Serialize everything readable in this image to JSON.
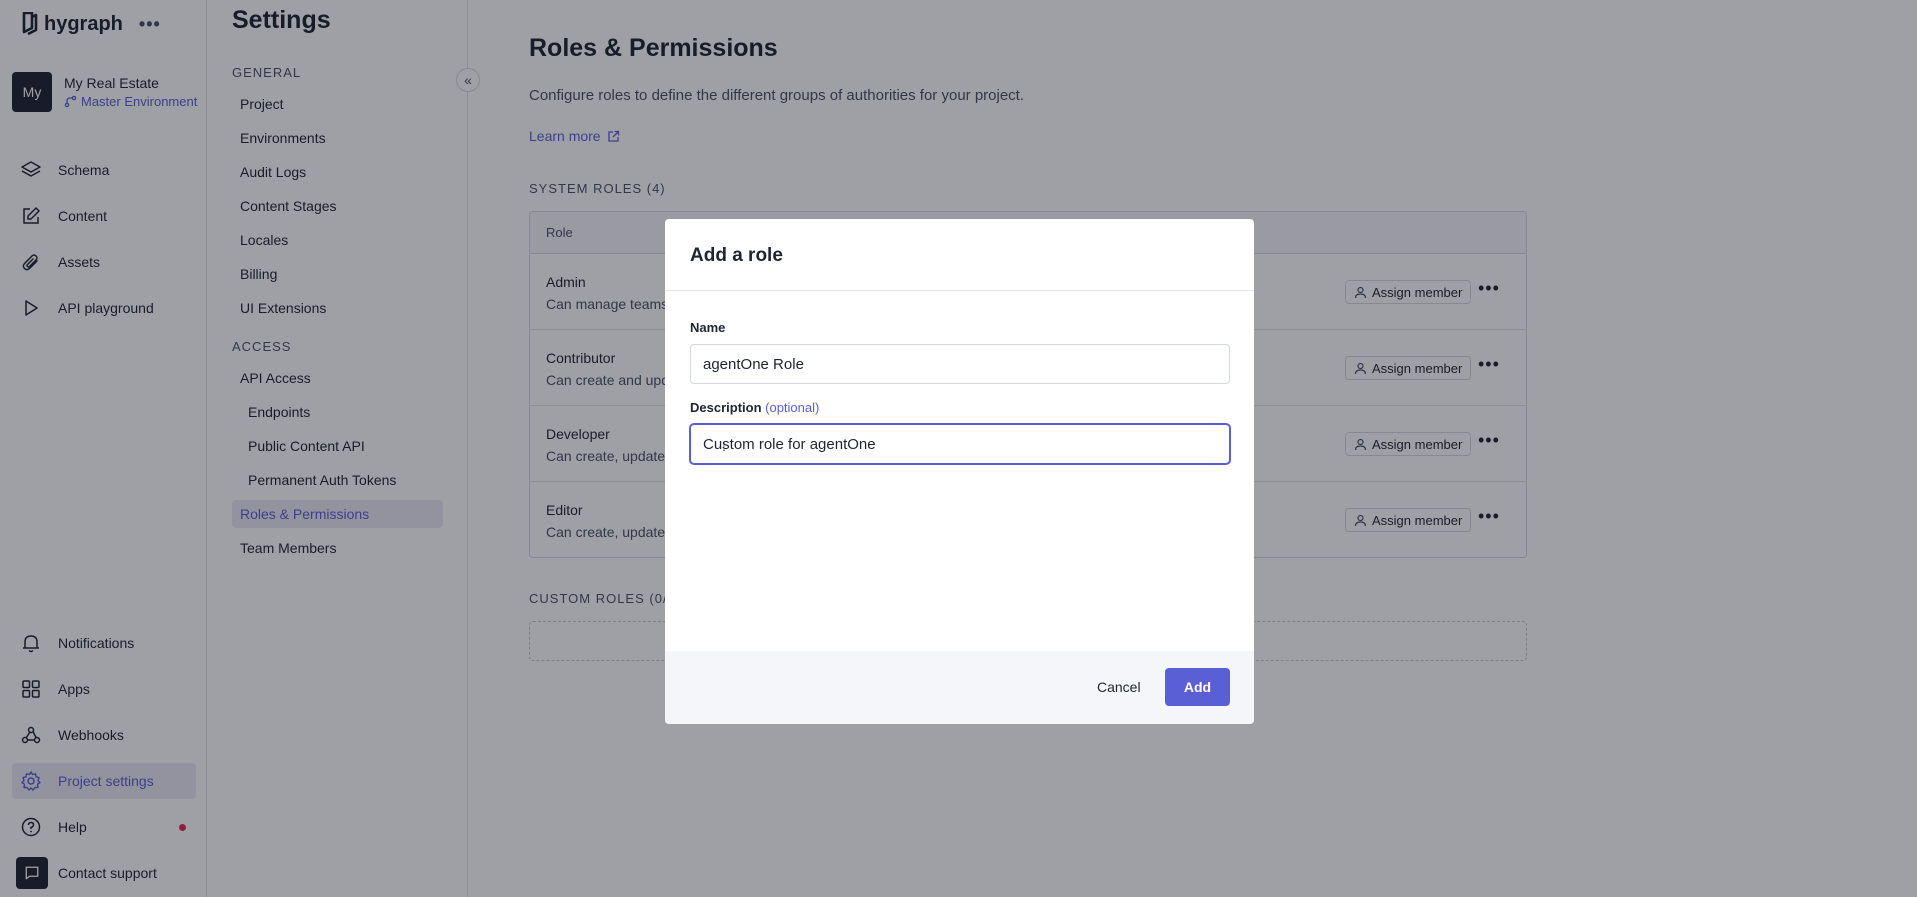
{
  "app": {
    "brand": "hygraph",
    "more": "•••"
  },
  "project": {
    "avatar": "My",
    "name": "My Real Estate",
    "environment": "Master Environment"
  },
  "nav": {
    "schema": "Schema",
    "content": "Content",
    "assets": "Assets",
    "api_playground": "API playground",
    "notifications": "Notifications",
    "apps": "Apps",
    "webhooks": "Webhooks",
    "project_settings": "Project settings",
    "help": "Help",
    "contact_support": "Contact support"
  },
  "settings": {
    "title": "Settings",
    "collapse": "«",
    "general_label": "GENERAL",
    "general": [
      "Project",
      "Environments",
      "Audit Logs",
      "Content Stages",
      "Locales",
      "Billing",
      "UI Extensions"
    ],
    "access_label": "ACCESS",
    "access": [
      "API Access",
      "Endpoints",
      "Public Content API",
      "Permanent Auth Tokens",
      "Roles & Permissions",
      "Team Members"
    ],
    "active": "Roles & Permissions"
  },
  "main": {
    "title": "Roles & Permissions",
    "description": "Configure roles to define the different groups of authorities for your project.",
    "learn_more": "Learn more",
    "system_roles_label": "SYSTEM ROLES (4)",
    "table_header": "Role",
    "roles": [
      {
        "name": "Admin",
        "desc": "Can manage teams"
      },
      {
        "name": "Contributor",
        "desc": "Can create and upd"
      },
      {
        "name": "Developer",
        "desc": "Can create, update"
      },
      {
        "name": "Editor",
        "desc": "Can create, update"
      }
    ],
    "assign_label": "Assign member",
    "row_more": "•••",
    "custom_roles_label": "CUSTOM ROLES (0/4"
  },
  "modal": {
    "title": "Add a role",
    "name_label": "Name",
    "name_value": "agentOne Role",
    "description_label": "Description",
    "description_optional": "(optional)",
    "description_value": "Custom role for agentOne",
    "cancel": "Cancel",
    "add": "Add"
  },
  "colors": {
    "accent": "#5a5fd6",
    "dark": "#1f2433",
    "help_dot": "#e0295d"
  }
}
